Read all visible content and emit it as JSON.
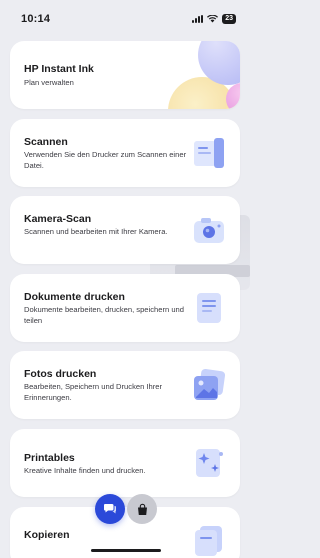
{
  "status_bar": {
    "time": "10:14",
    "battery": "23"
  },
  "cards": [
    {
      "title": "HP Instant Ink",
      "desc": "Plan verwalten"
    },
    {
      "title": "Scannen",
      "desc": "Verwenden Sie den Drucker zum Scannen einer Datei."
    },
    {
      "title": "Kamera-Scan",
      "desc": "Scannen und bearbeiten mit Ihrer Kamera."
    },
    {
      "title": "Dokumente drucken",
      "desc": "Dokumente bearbeiten, drucken, speichern und teilen"
    },
    {
      "title": "Fotos drucken",
      "desc": "Bearbeiten, Speichern und Drucken Ihrer Erinnerungen."
    },
    {
      "title": "Printables",
      "desc": "Kreative Inhalte finden und drucken."
    },
    {
      "title": "Kopieren",
      "desc": ""
    }
  ],
  "icons": {
    "scan": "scanner-icon",
    "camera": "camera-icon",
    "documents": "document-icon",
    "photos": "photo-icon",
    "printables": "sparkle-icon",
    "copy": "copy-icon",
    "fab_primary": "chat-icon",
    "fab_secondary": "shopping-bag-icon"
  },
  "colors": {
    "accent": "#2b49d9",
    "icon_light": "#c9d4fb",
    "icon_dark": "#6f86ee"
  }
}
